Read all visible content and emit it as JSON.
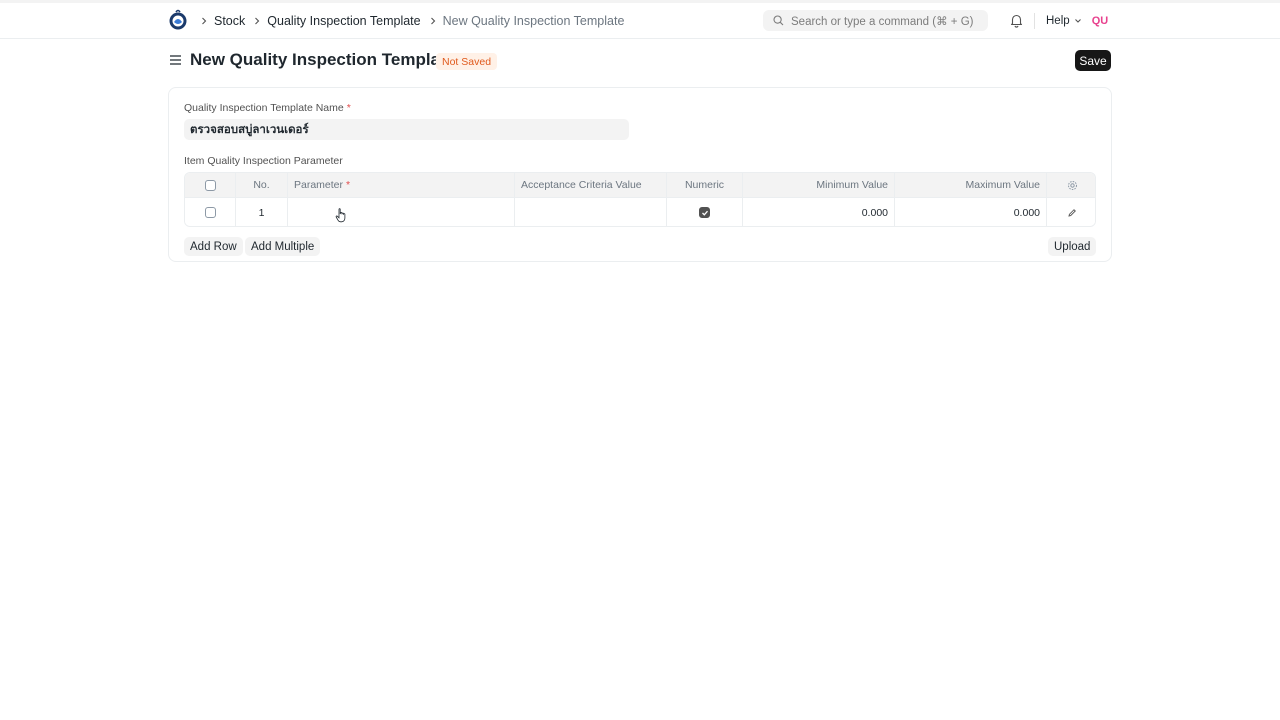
{
  "navbar": {
    "breadcrumbs": [
      "Stock",
      "Quality Inspection Template",
      "New Quality Inspection Template"
    ],
    "search_placeholder": "Search or type a command (⌘ + G)",
    "help_label": "Help",
    "avatar_initials": "QU"
  },
  "page": {
    "title": "New Quality Inspection Template",
    "status_badge": "Not Saved",
    "save_label": "Save"
  },
  "form": {
    "template_name_label": "Quality Inspection Template Name",
    "required_mark": "*",
    "template_name_value": "ตรวจสอบสบู่ลาเวนเดอร์",
    "table_label": "Item Quality Inspection Parameter",
    "columns": [
      "No.",
      "Parameter",
      "Acceptance Criteria Value",
      "Numeric",
      "Minimum Value",
      "Maximum Value"
    ],
    "rows": [
      {
        "no": "1",
        "parameter": "",
        "acceptance": "",
        "numeric": true,
        "min": "0.000",
        "max": "0.000"
      }
    ],
    "add_row_label": "Add Row",
    "add_multiple_label": "Add Multiple",
    "upload_label": "Upload"
  },
  "colors": {
    "primary_button": "#171717",
    "badge_bg": "#fff1e7",
    "badge_text": "#e05a1d",
    "avatar_text": "#e8418e"
  }
}
